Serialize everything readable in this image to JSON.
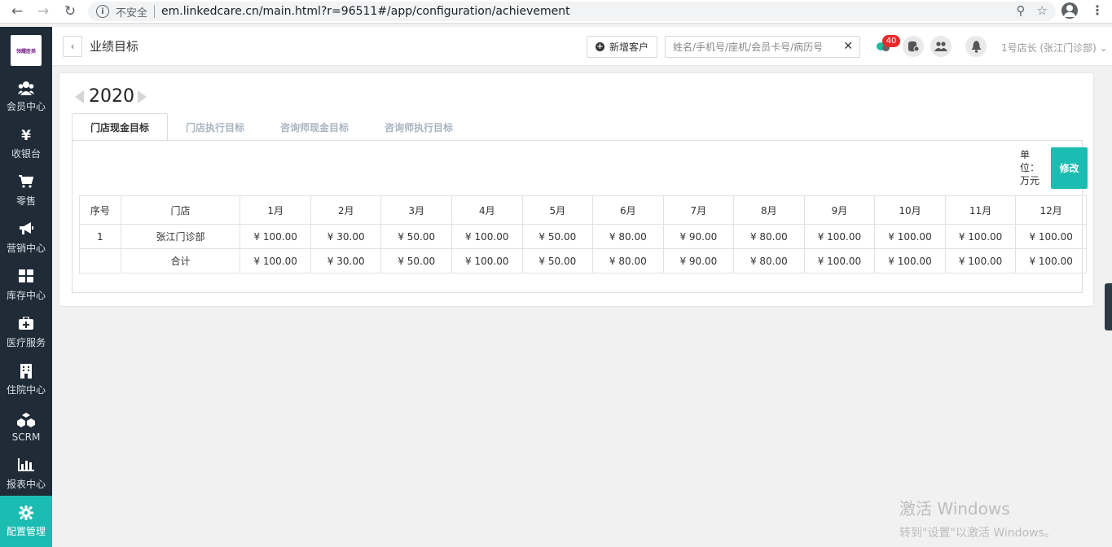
{
  "browser": {
    "insecure_label": "不安全",
    "url": "em.linkedcare.cn/main.html?r=96511#/app/configuration/achievement"
  },
  "sidebar": {
    "logo_text": "领耀医美",
    "items": [
      {
        "label": "会员中心",
        "icon": "members-icon"
      },
      {
        "label": "收银台",
        "icon": "yen-icon"
      },
      {
        "label": "零售",
        "icon": "cart-icon"
      },
      {
        "label": "营销中心",
        "icon": "megaphone-icon"
      },
      {
        "label": "库存中心",
        "icon": "grid-icon"
      },
      {
        "label": "医疗服务",
        "icon": "medical-kit-icon"
      },
      {
        "label": "住院中心",
        "icon": "building-icon"
      },
      {
        "label": "SCRM",
        "icon": "cubes-icon"
      },
      {
        "label": "报表中心",
        "icon": "bar-chart-icon"
      },
      {
        "label": "配置管理",
        "icon": "gear-icon"
      }
    ]
  },
  "header": {
    "title": "业绩目标",
    "new_customer_label": "新增客户",
    "search_placeholder": "姓名/手机号/座机/会员卡号/病历号",
    "badge_count": "40",
    "user_label": "1号店长 (张江门诊部)"
  },
  "main": {
    "year": "2020",
    "tabs": [
      "门店现金目标",
      "门店执行目标",
      "咨询师现金目标",
      "咨询师执行目标"
    ],
    "unit_label": "单位：万元",
    "edit_label": "修改",
    "table": {
      "headers": [
        "序号",
        "门店",
        "1月",
        "2月",
        "3月",
        "4月",
        "5月",
        "6月",
        "7月",
        "8月",
        "9月",
        "10月",
        "11月",
        "12月"
      ],
      "rows": [
        [
          "1",
          "张江门诊部",
          "¥ 100.00",
          "¥ 30.00",
          "¥ 50.00",
          "¥ 100.00",
          "¥ 50.00",
          "¥ 80.00",
          "¥ 90.00",
          "¥ 80.00",
          "¥ 100.00",
          "¥ 100.00",
          "¥ 100.00",
          "¥ 100.00"
        ],
        [
          "",
          "合计",
          "¥ 100.00",
          "¥ 30.00",
          "¥ 50.00",
          "¥ 100.00",
          "¥ 50.00",
          "¥ 80.00",
          "¥ 90.00",
          "¥ 80.00",
          "¥ 100.00",
          "¥ 100.00",
          "¥ 100.00",
          "¥ 100.00"
        ]
      ]
    }
  },
  "watermark": {
    "title": "激活 Windows",
    "subtitle": "转到\"设置\"以激活 Windows。"
  }
}
